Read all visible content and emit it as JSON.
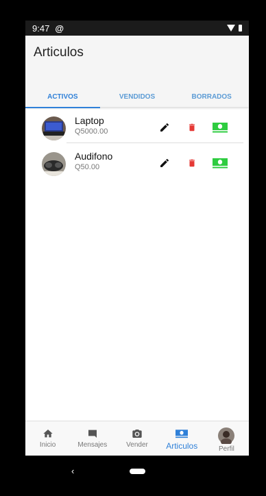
{
  "status": {
    "time": "9:47",
    "sync_glyph": "@"
  },
  "appbar": {
    "title": "Articulos"
  },
  "tabs": [
    {
      "label": "ACTIVOS",
      "active": true
    },
    {
      "label": "VENDIDOS",
      "active": false
    },
    {
      "label": "BORRADOS",
      "active": false
    }
  ],
  "items": [
    {
      "name": "Laptop",
      "price": "Q5000.00"
    },
    {
      "name": "Audifono",
      "price": "Q50.00"
    }
  ],
  "bottom_nav": [
    {
      "label": "Inicio",
      "icon": "home-icon"
    },
    {
      "label": "Mensajes",
      "icon": "chat-icon"
    },
    {
      "label": "Vender",
      "icon": "camera-icon"
    },
    {
      "label": "Articulos",
      "icon": "money-icon",
      "active": true
    },
    {
      "label": "Perfil",
      "icon": "avatar"
    }
  ],
  "sysnav": {
    "back_glyph": "‹"
  },
  "colors": {
    "accent": "#2f80d8",
    "delete": "#e53935",
    "money": "#2ecc40"
  }
}
